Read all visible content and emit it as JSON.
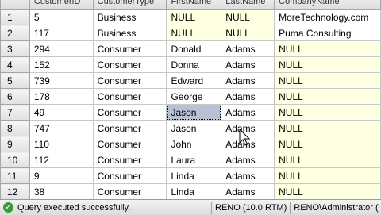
{
  "grid": {
    "columns": [
      "CustomerID",
      "CustomerType",
      "FirstName",
      "LastName",
      "CompanyName"
    ],
    "rows": [
      {
        "num": "1",
        "cells": [
          "5",
          "Business",
          "NULL",
          "NULL",
          "MoreTechnology.com"
        ]
      },
      {
        "num": "2",
        "cells": [
          "117",
          "Business",
          "NULL",
          "NULL",
          "Puma Consulting"
        ]
      },
      {
        "num": "3",
        "cells": [
          "294",
          "Consumer",
          "Donald",
          "Adams",
          "NULL"
        ]
      },
      {
        "num": "4",
        "cells": [
          "152",
          "Consumer",
          "Donna",
          "Adams",
          "NULL"
        ]
      },
      {
        "num": "5",
        "cells": [
          "739",
          "Consumer",
          "Edward",
          "Adams",
          "NULL"
        ]
      },
      {
        "num": "6",
        "cells": [
          "178",
          "Consumer",
          "George",
          "Adams",
          "NULL"
        ]
      },
      {
        "num": "7",
        "cells": [
          "49",
          "Consumer",
          "Jason",
          "Adams",
          "NULL"
        ]
      },
      {
        "num": "8",
        "cells": [
          "747",
          "Consumer",
          "Jason",
          "Adams",
          "NULL"
        ]
      },
      {
        "num": "9",
        "cells": [
          "110",
          "Consumer",
          "John",
          "Adams",
          "NULL"
        ]
      },
      {
        "num": "10",
        "cells": [
          "112",
          "Consumer",
          "Laura",
          "Adams",
          "NULL"
        ]
      },
      {
        "num": "11",
        "cells": [
          "9",
          "Consumer",
          "Linda",
          "Adams",
          "NULL"
        ]
      },
      {
        "num": "12",
        "cells": [
          "38",
          "Consumer",
          "Linda",
          "Adams",
          "NULL"
        ]
      }
    ],
    "selected_cell": {
      "row": 7,
      "column": "FirstName"
    }
  },
  "statusbar": {
    "message": "Query executed successfully.",
    "server": "RENO (10.0 RTM)",
    "user": "RENO\\Administrator ("
  },
  "colors": {
    "null_cell": "#ffffe1",
    "selected_cell": "#b7c1d3",
    "success_icon": "#3c9a3c"
  },
  "icons": {
    "status": "check-circle-icon",
    "pointer": "mouse-cursor-icon"
  }
}
